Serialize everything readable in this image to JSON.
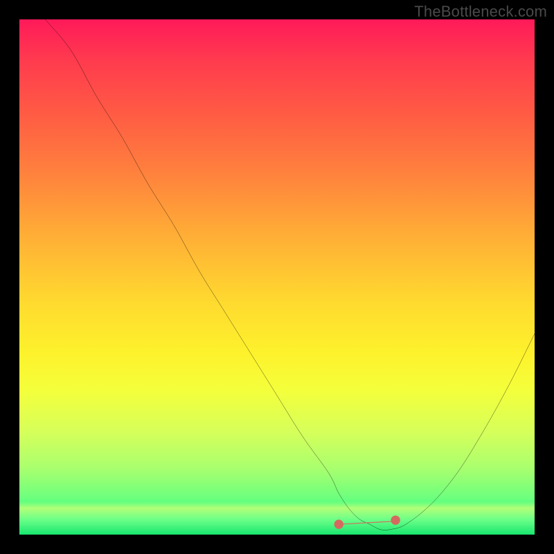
{
  "watermark": "TheBottleneck.com",
  "colors": {
    "curve": "#000000",
    "marker": "#d46a5f",
    "frame_bg": "#000000"
  },
  "chart_data": {
    "type": "line",
    "title": "",
    "xlabel": "",
    "ylabel": "",
    "xlim": [
      0,
      100
    ],
    "ylim": [
      0,
      100
    ],
    "grid": false,
    "legend": false,
    "series": [
      {
        "name": "bottleneck-curve",
        "x": [
          5,
          10,
          15,
          20,
          25,
          30,
          35,
          40,
          45,
          50,
          55,
          60,
          62,
          64,
          66,
          68,
          70,
          72,
          75,
          80,
          85,
          90,
          95,
          100
        ],
        "y": [
          100,
          94,
          85,
          77,
          68,
          60,
          51,
          43,
          35,
          27,
          19,
          12,
          8,
          5,
          3,
          2,
          1,
          1,
          2,
          6,
          12,
          20,
          29,
          39
        ]
      }
    ],
    "annotations": {
      "valley_marker": {
        "shape": "flat-segment-with-dots",
        "color": "#d46a5f",
        "x_start": 62,
        "x_end": 73,
        "y": 2
      }
    },
    "background": "rainbow-gradient-vertical"
  }
}
